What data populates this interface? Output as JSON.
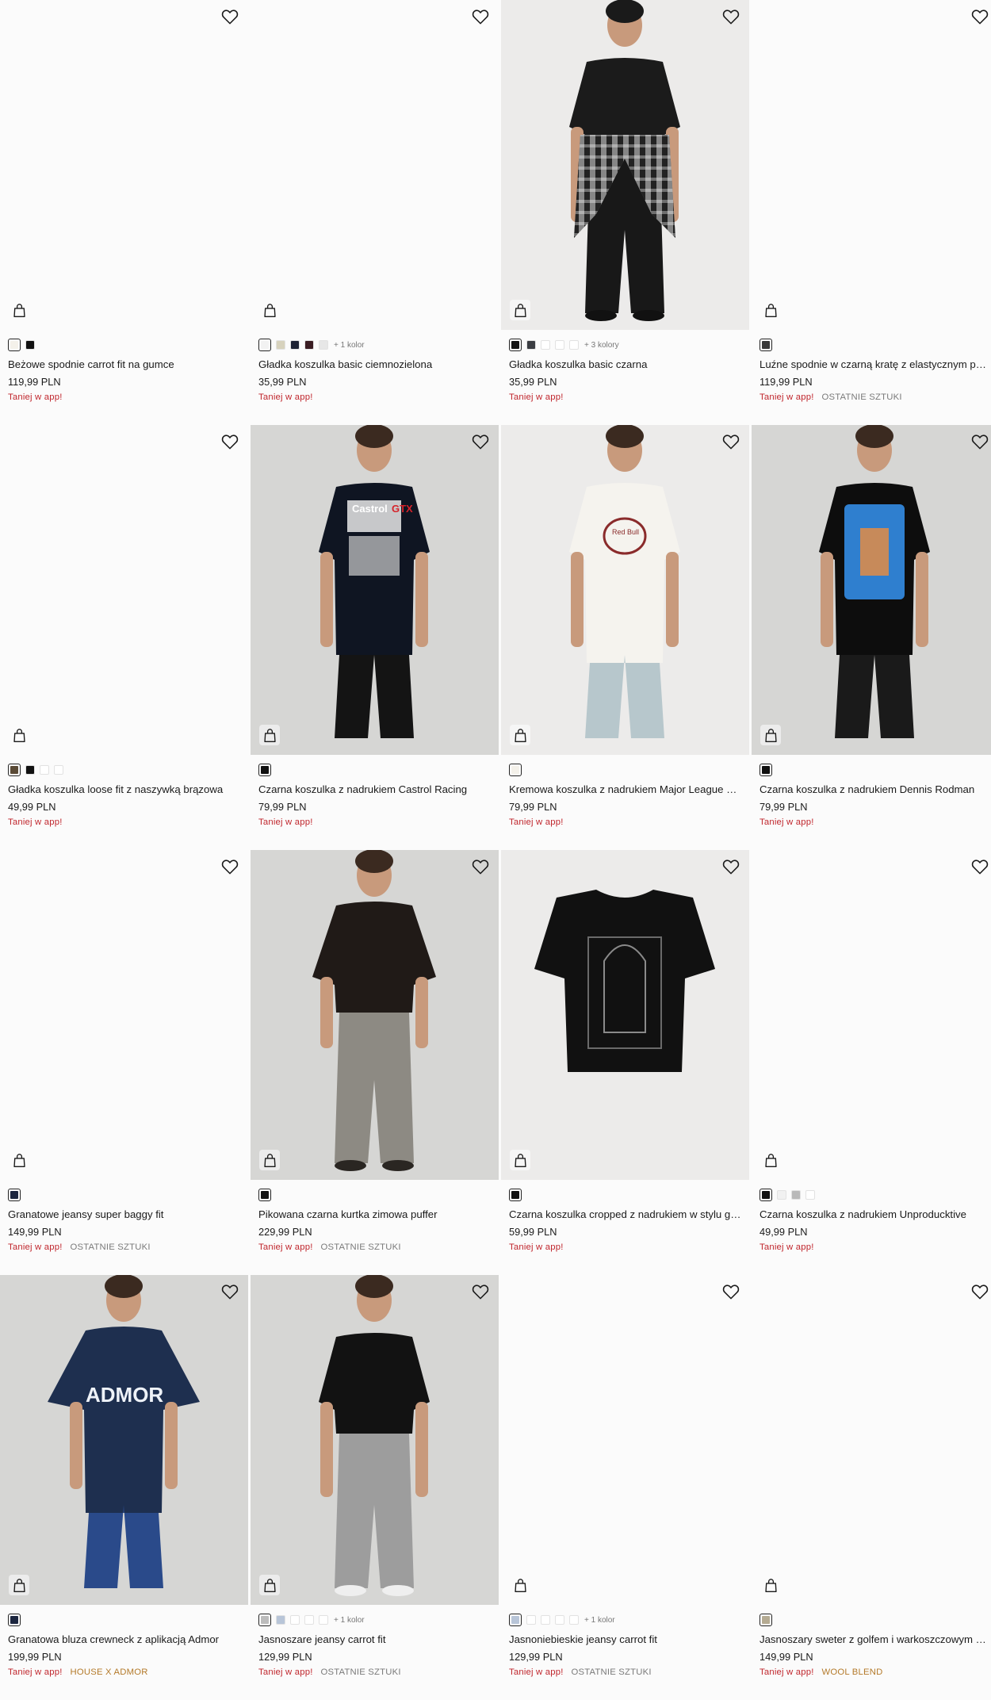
{
  "products": [
    {
      "name": "Beżowe spodnie carrot fit na gumce",
      "price": "119,99 PLN",
      "promo": "Taniej w app!",
      "tag": "",
      "has_photo": false,
      "swatches": [
        "#f4f1ea",
        "#111111"
      ],
      "more": ""
    },
    {
      "name": "Gładka koszulka basic ciemnozielona",
      "price": "35,99 PLN",
      "promo": "Taniej w app!",
      "tag": "",
      "has_photo": false,
      "swatches": [
        "#f2f2f2",
        "#d7d2bd",
        "#1d2233",
        "#3a1c22",
        "#e7e7e7"
      ],
      "more": "+ 1 kolor"
    },
    {
      "name": "Gładka koszulka basic czarna",
      "price": "35,99 PLN",
      "promo": "Taniej w app!",
      "tag": "",
      "has_photo": true,
      "photo": "tee-plaid",
      "swatches": [
        "#141414",
        "#3b3d42",
        "#ffffff",
        "#ffffff",
        "#ffffff"
      ],
      "more": "+ 3 kolory"
    },
    {
      "name": "Luźne spodnie w czarną kratę z elastycznym pasem",
      "price": "119,99 PLN",
      "promo": "Taniej w app!",
      "tag": "OSTATNIE SZTUKI",
      "has_photo": false,
      "swatches": [
        "#3a3a3a"
      ],
      "more": ""
    },
    {
      "name": "Gładka koszulka loose fit z naszywką brązowa",
      "price": "49,99 PLN",
      "promo": "Taniej w app!",
      "tag": "",
      "has_photo": false,
      "swatches": [
        "#5a4a36",
        "#111111",
        "#ffffff",
        "#ffffff"
      ],
      "more": ""
    },
    {
      "name": "Czarna koszulka z nadrukiem Castrol Racing",
      "price": "79,99 PLN",
      "promo": "Taniej w app!",
      "tag": "",
      "has_photo": true,
      "photo": "castrol",
      "swatches": [
        "#111111"
      ],
      "more": ""
    },
    {
      "name": "Kremowa koszulka z nadrukiem Major League Soccer",
      "price": "79,99 PLN",
      "promo": "Taniej w app!",
      "tag": "",
      "has_photo": true,
      "photo": "redbull",
      "swatches": [
        "#f4f1ea"
      ],
      "more": ""
    },
    {
      "name": "Czarna koszulka z nadrukiem Dennis Rodman",
      "price": "79,99 PLN",
      "promo": "Taniej w app!",
      "tag": "",
      "has_photo": true,
      "photo": "rodman",
      "swatches": [
        "#111111"
      ],
      "more": ""
    },
    {
      "name": "Granatowe jeansy super baggy fit",
      "price": "149,99 PLN",
      "promo": "Taniej w app!",
      "tag": "OSTATNIE SZTUKI",
      "has_photo": false,
      "swatches": [
        "#1c2640"
      ],
      "more": ""
    },
    {
      "name": "Pikowana czarna kurtka zimowa puffer",
      "price": "229,99 PLN",
      "promo": "Taniej w app!",
      "tag": "OSTATNIE SZTUKI",
      "has_photo": true,
      "photo": "puffer",
      "swatches": [
        "#111111"
      ],
      "more": ""
    },
    {
      "name": "Czarna koszulka cropped z nadrukiem w stylu grunge",
      "price": "59,99 PLN",
      "promo": "Taniej w app!",
      "tag": "",
      "has_photo": true,
      "photo": "flatlay",
      "swatches": [
        "#111111"
      ],
      "more": ""
    },
    {
      "name": "Czarna koszulka z nadrukiem Unproducktive",
      "price": "49,99 PLN",
      "promo": "Taniej w app!",
      "tag": "",
      "has_photo": false,
      "swatches": [
        "#111111",
        "#f1f1f1",
        "#b9b9b9",
        "#ffffff"
      ],
      "more": ""
    },
    {
      "name": "Granatowa bluza crewneck z aplikacją Admor",
      "price": "199,99 PLN",
      "promo": "Taniej w app!",
      "tag": "HOUSE X ADMOR",
      "tag_style": "brand",
      "has_photo": true,
      "photo": "admor",
      "swatches": [
        "#1c2640"
      ],
      "more": ""
    },
    {
      "name": "Jasnoszare jeansy carrot fit",
      "price": "129,99 PLN",
      "promo": "Taniej w app!",
      "tag": "OSTATNIE SZTUKI",
      "has_photo": true,
      "photo": "jeans",
      "swatches": [
        "#bcbcbc",
        "#b8c5d8",
        "#ffffff",
        "#ffffff",
        "#ffffff"
      ],
      "more": "+ 1 kolor"
    },
    {
      "name": "Jasnoniebieskie jeansy carrot fit",
      "price": "129,99 PLN",
      "promo": "Taniej w app!",
      "tag": "OSTATNIE SZTUKI",
      "has_photo": false,
      "swatches": [
        "#b8c5d8",
        "#ffffff",
        "#ffffff",
        "#ffffff",
        "#ffffff"
      ],
      "more": "+ 1 kolor"
    },
    {
      "name": "Jasnoszary sweter z golfem i warkoszczowym splotem",
      "price": "149,99 PLN",
      "promo": "Taniej w app!",
      "tag": "WOOL BLEND",
      "tag_style": "brand",
      "has_photo": false,
      "swatches": [
        "#b5ab93"
      ],
      "more": ""
    }
  ],
  "icons": {
    "favorite": "heart-icon",
    "cart": "shopping-bag-icon"
  },
  "colors": {
    "promo": "#c0262d",
    "tag": "#7a7a7a",
    "brand_tag": "#b47a2a"
  }
}
